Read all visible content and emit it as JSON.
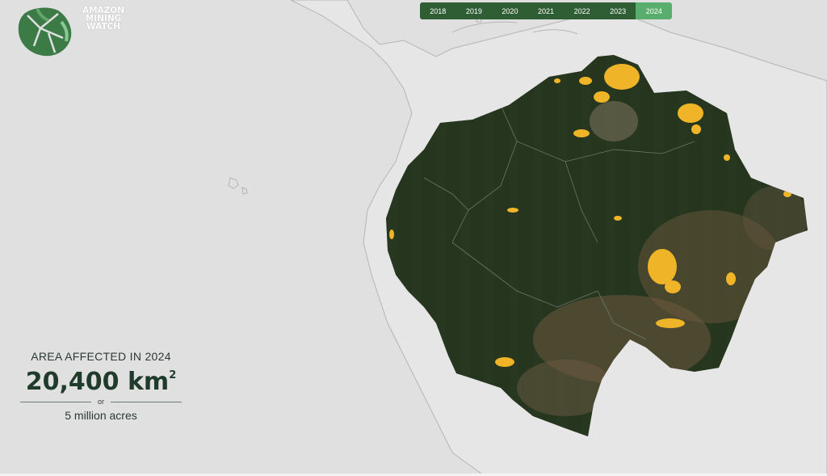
{
  "brand": {
    "name": "AMAZON MINING WATCH",
    "lines": [
      "AMAZON",
      "MINING",
      "WATCH"
    ]
  },
  "years": [
    "2018",
    "2019",
    "2020",
    "2021",
    "2022",
    "2023",
    "2024"
  ],
  "selected_year": "2024",
  "stats": {
    "label": "AREA AFFECTED IN 2024",
    "value": "20,400 km",
    "unit_superscript": "2",
    "separator": "or",
    "alt_value": "5 million acres"
  },
  "colors": {
    "background": "#e0e0e0",
    "forest": "#24331f",
    "mining": "#f0b429",
    "tab": "#2f5e34",
    "tab_active": "#5aae6d"
  },
  "icons": {
    "logo": "leaf-logo-icon"
  }
}
